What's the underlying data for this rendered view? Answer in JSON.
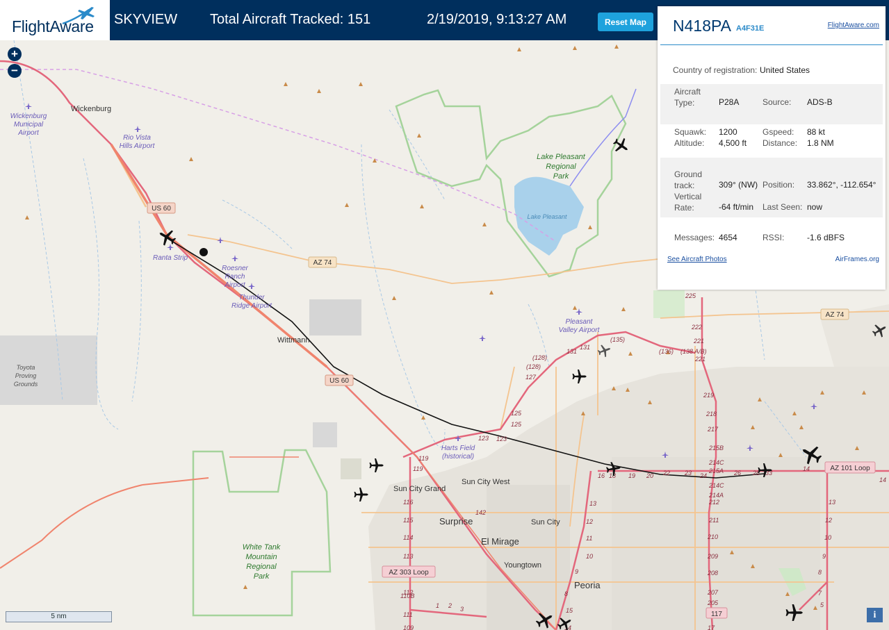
{
  "header": {
    "logo_text": "FlightAware",
    "app_name": "SKYVIEW",
    "total_tracked": "Total Aircraft Tracked: 151",
    "datetime": "2/19/2019, 9:13:27 AM",
    "reset_label": "Reset Map"
  },
  "map_controls": {
    "zoom_in": "+",
    "zoom_out": "−",
    "scale": "5 nm",
    "info": "i"
  },
  "panel": {
    "registration": "N418PA",
    "hex_code": "A4F31E",
    "link": "FlightAware.com",
    "country_label": "Country of registration:",
    "country": "United States",
    "aircraft_type_label": "Aircraft Type:",
    "aircraft_type": "P28A",
    "source_label": "Source:",
    "source": "ADS-B",
    "squawk_label": "Squawk:",
    "squawk": "1200",
    "gspeed_label": "Gspeed:",
    "gspeed": "88 kt",
    "altitude_label": "Altitude:",
    "altitude": "4,500 ft",
    "distance_label": "Distance:",
    "distance": "1.8 NM",
    "ground_track_label": "Ground track:",
    "ground_track": "309° (NW)",
    "position_label": "Position:",
    "position": "33.862°, -112.654°",
    "vertical_rate_label": "Vertical Rate:",
    "vertical_rate": "-64 ft/min",
    "last_seen_label": "Last Seen:",
    "last_seen": "now",
    "messages_label": "Messages:",
    "messages": "4654",
    "rssi_label": "RSSI:",
    "rssi": "-1.6 dBFS",
    "photos_link": "See Aircraft Photos",
    "airframes_link": "AirFrames.org"
  },
  "map_labels": {
    "towns": {
      "wickenburg": "Wickenburg",
      "wittmann": "Wittmann",
      "surprise": "Surprise",
      "el_mirage": "El Mirage",
      "sun_city": "Sun City",
      "sun_city_west": "Sun City West",
      "sun_city_grand": "Sun City Grand",
      "youngtown": "Youngtown",
      "peoria": "Peoria"
    },
    "airports": {
      "wickenburg_muni": [
        "Wickenburg",
        "Municipal",
        "Airport"
      ],
      "rio_vista": [
        "Rio Vista",
        "Hills Airport"
      ],
      "ranta": "Ranta Strip",
      "roesner": [
        "Roesner",
        "Ranch",
        "Airport"
      ],
      "thunder": [
        "Thunder",
        "Ridge Airport"
      ],
      "pleasant_valley": [
        "Pleasant",
        "Valley Airport"
      ],
      "harts": [
        "Harts Field",
        "(historical)"
      ]
    },
    "areas": {
      "lake_pleasant_park": [
        "Lake Pleasant",
        "Regional",
        "Park"
      ],
      "lake_pleasant": "Lake Pleasant",
      "white_tank": [
        "White Tank",
        "Mountain",
        "Regional",
        "Park"
      ],
      "toyota": [
        "Toyota",
        "Proving",
        "Grounds"
      ]
    },
    "roads": {
      "us60_a": "US 60",
      "us60_b": "US 60",
      "az74_a": "AZ 74",
      "az74_b": "AZ 74",
      "az303": "AZ 303 Loop",
      "az101": "AZ 101 Loop",
      "r117": "117"
    },
    "exits": [
      "119",
      "119",
      "116",
      "115",
      "114",
      "113",
      "112",
      "111",
      "110B",
      "109",
      "142",
      "1",
      "2",
      "3",
      "123",
      "123",
      "125",
      "125",
      "127",
      "(128)",
      "(128)",
      "131",
      "131",
      "(135)",
      "(136)",
      "(138 A/B)",
      "225",
      "222",
      "221",
      "221",
      "219",
      "218",
      "217",
      "215B",
      "214C",
      "215A",
      "214C",
      "214A",
      "212",
      "211",
      "210",
      "209",
      "208",
      "207",
      "205",
      "17",
      "16",
      "18",
      "19",
      "20",
      "22",
      "23",
      "24",
      "26",
      "28",
      "33",
      "14",
      "14",
      "13",
      "12",
      "11",
      "10",
      "9",
      "8",
      "15",
      "14",
      "13",
      "12",
      "10",
      "9",
      "8",
      "7",
      "5"
    ]
  }
}
